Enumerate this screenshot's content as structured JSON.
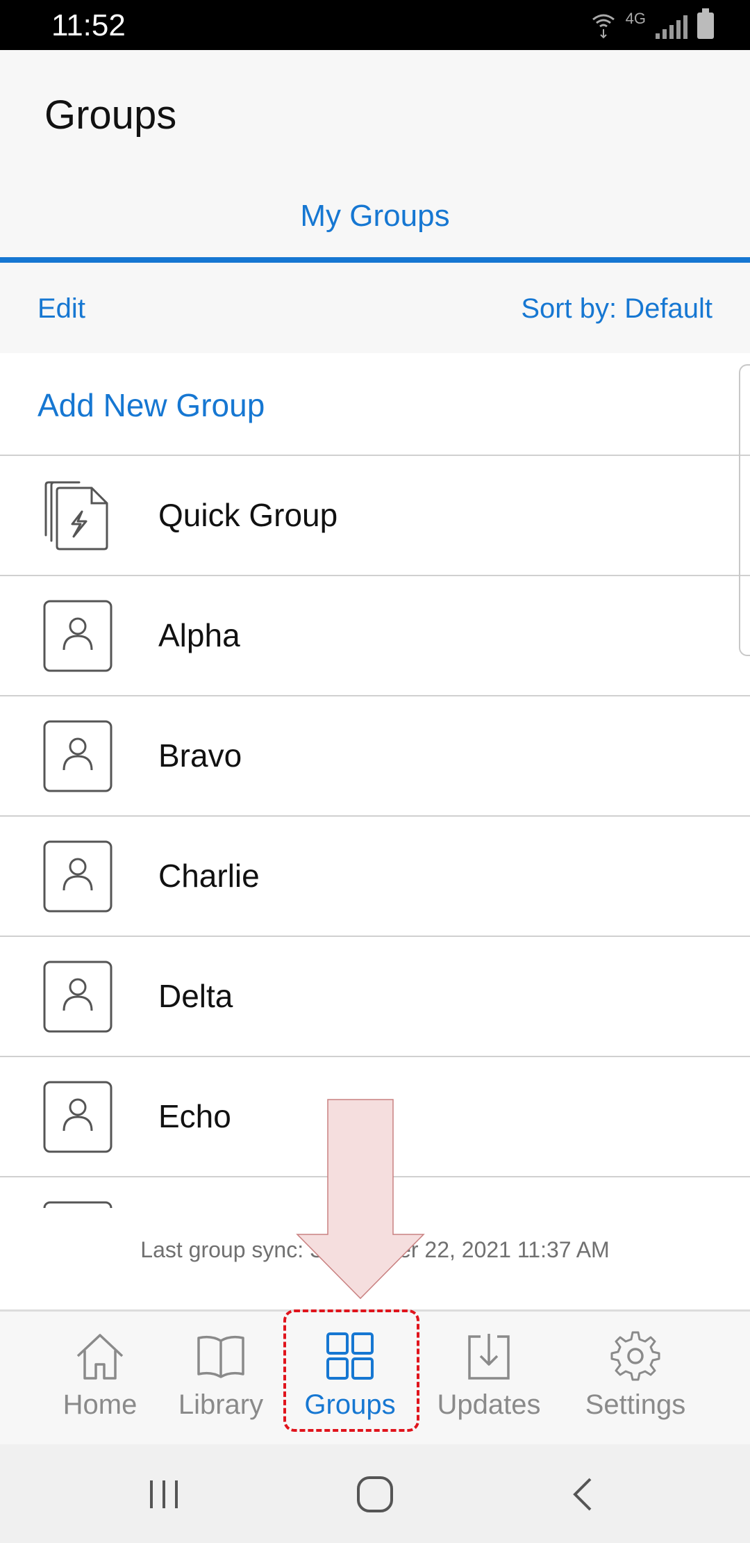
{
  "status_bar": {
    "time": "11:52",
    "network": "4G"
  },
  "header": {
    "title": "Groups"
  },
  "tabs": [
    {
      "label": "My Groups",
      "active": true
    }
  ],
  "toolbar": {
    "edit_label": "Edit",
    "sort_label": "Sort by: Default"
  },
  "list": {
    "add_label": "Add New Group",
    "groups": [
      {
        "name": "Quick Group",
        "icon": "quick-group-icon"
      },
      {
        "name": "Alpha",
        "icon": "person-icon"
      },
      {
        "name": "Bravo",
        "icon": "person-icon"
      },
      {
        "name": "Charlie",
        "icon": "person-icon"
      },
      {
        "name": "Delta",
        "icon": "person-icon"
      },
      {
        "name": "Echo",
        "icon": "person-icon"
      }
    ]
  },
  "sync_text": "Last group sync: September 22, 2021 11:37 AM",
  "bottom_nav": [
    {
      "label": "Home",
      "icon": "home-icon"
    },
    {
      "label": "Library",
      "icon": "book-icon"
    },
    {
      "label": "Groups",
      "icon": "grid-icon",
      "active": true
    },
    {
      "label": "Updates",
      "icon": "download-icon"
    },
    {
      "label": "Settings",
      "icon": "gear-icon"
    }
  ],
  "colors": {
    "accent": "#1677d2",
    "highlight": "#e0141c",
    "arrow_fill": "#f5dede"
  }
}
